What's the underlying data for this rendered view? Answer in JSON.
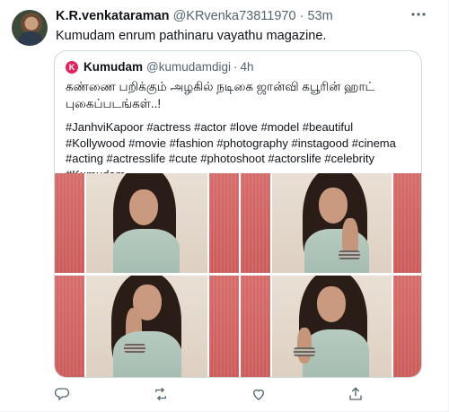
{
  "tweet": {
    "author_name": "K.R.venkataraman",
    "author_handle": "@KRvenka73811970",
    "separator": "·",
    "time": "53m",
    "text": "Kumudam enrum pathinaru vayathu magazine."
  },
  "quoted_tweet": {
    "logo_letter": "K",
    "author_name": "Kumudam",
    "author_handle": "@kumudamdigi",
    "separator": "·",
    "time": "4h",
    "tamil_text": "கண்ணை பறிக்கும் அழகில் நடிகை ஜான்வி கபூரின் ஹாட் புகைப்படங்கள்..!",
    "hashtags": "#JanhviKapoor #actress #actor #love #model #beautiful #Kollywood #movie #fashion #photography #instagood #cinema #acting #actresslife #cute #photoshoot #actorslife #celebrity #Kumudam"
  },
  "colors": {
    "text": "#0f1419",
    "secondary": "#536471",
    "border": "#cfd9de",
    "pink_panel": "#d66a69",
    "brand": "#e0245e"
  },
  "icons": {
    "more": "more-horizontal-icon",
    "reply": "reply-icon",
    "retweet": "retweet-icon",
    "like": "heart-icon",
    "share": "share-icon"
  }
}
